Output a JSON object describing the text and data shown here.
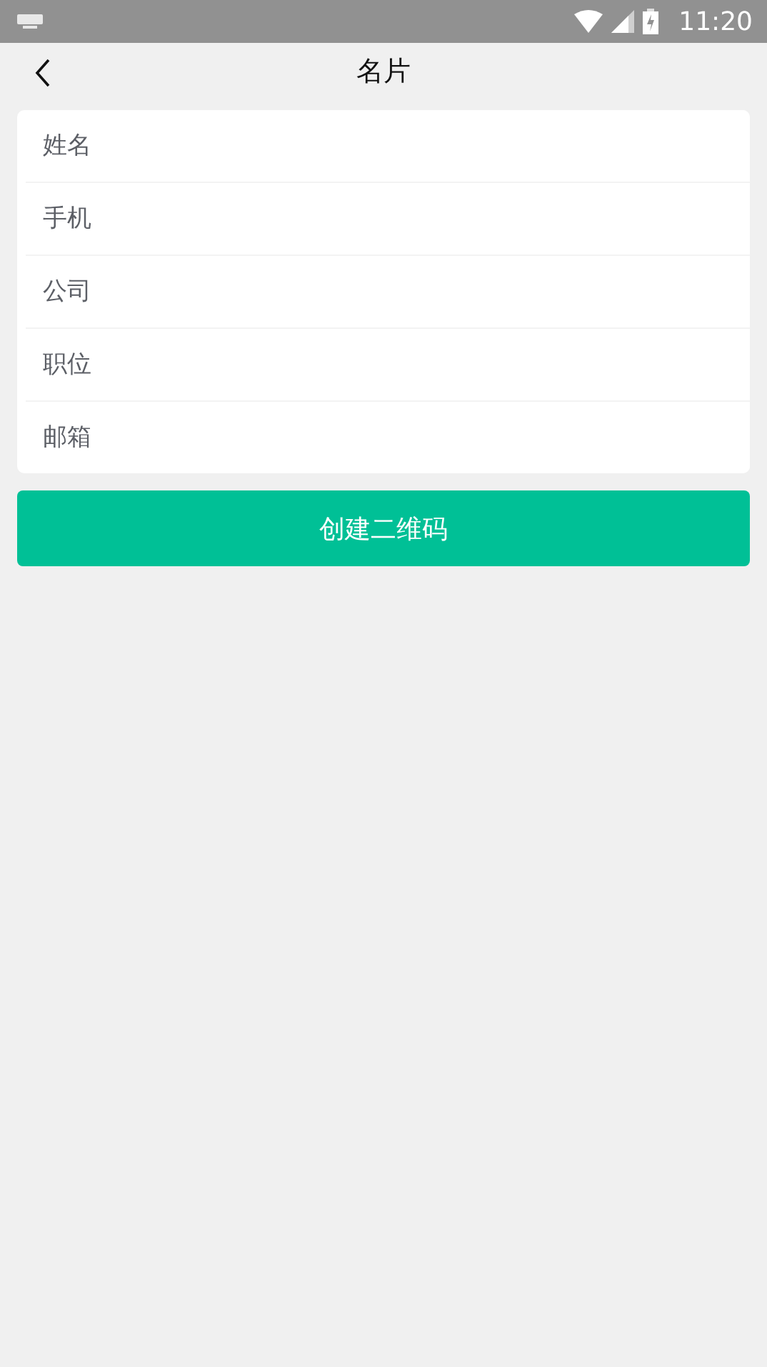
{
  "status_bar": {
    "time": "11:20"
  },
  "header": {
    "title": "名片"
  },
  "fields": [
    {
      "placeholder": "姓名"
    },
    {
      "placeholder": "手机"
    },
    {
      "placeholder": "公司"
    },
    {
      "placeholder": "职位"
    },
    {
      "placeholder": "邮箱"
    }
  ],
  "button": {
    "label": "创建二维码"
  }
}
